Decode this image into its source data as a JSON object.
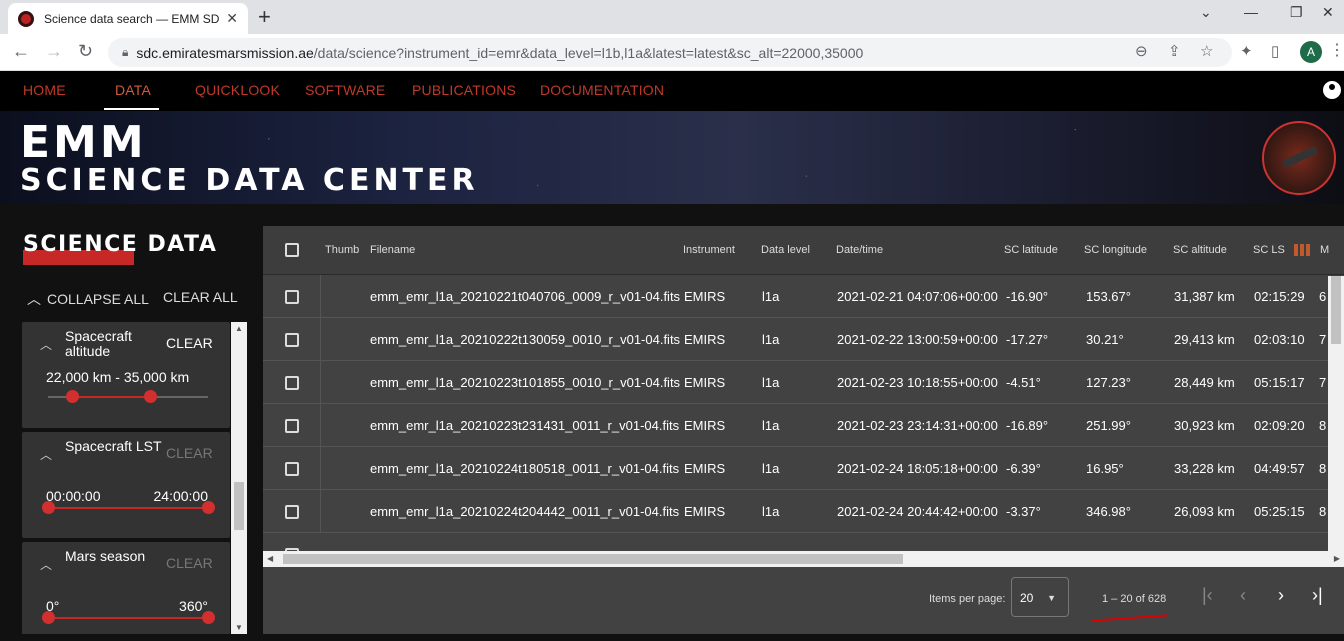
{
  "browser": {
    "tab_title": "Science data search — EMM SDC",
    "tab_close": "✕",
    "new_tab": "+",
    "url_host": "sdc.emiratesmarsmission.ae",
    "url_path": "/data/science?instrument_id=emr&data_level=l1b,l1a&latest=latest&sc_alt=22000,35000",
    "profile_initial": "A"
  },
  "nav": {
    "items": [
      "HOME",
      "DATA",
      "QUICKLOOK",
      "SOFTWARE",
      "PUBLICATIONS",
      "DOCUMENTATION"
    ],
    "active": "DATA"
  },
  "banner": {
    "line1": "EMM",
    "line2": "SCIENCE DATA CENTER"
  },
  "sidebar": {
    "title": "SCIENCE DATA",
    "collapse_all": "COLLAPSE ALL",
    "clear_all": "CLEAR ALL",
    "filters": [
      {
        "name": "Spacecraft altitude",
        "clear": "CLEAR",
        "active": true,
        "range_text": "22,000 km - 35,000 km",
        "min_label": "",
        "max_label": "",
        "low": 0.15,
        "high": 0.64
      },
      {
        "name": "Spacecraft LST",
        "clear": "CLEAR",
        "active": false,
        "range_text": "",
        "min_label": "00:00:00",
        "max_label": "24:00:00",
        "low": 0.0,
        "high": 1.0
      },
      {
        "name": "Mars season",
        "clear": "CLEAR",
        "active": false,
        "range_text": "",
        "min_label": "0°",
        "max_label": "360°",
        "low": 0.0,
        "high": 1.0
      }
    ]
  },
  "table": {
    "headers": {
      "thumb": "Thumb",
      "filename": "Filename",
      "instrument": "Instrument",
      "data_level": "Data level",
      "datetime": "Date/time",
      "sc_latitude": "SC latitude",
      "sc_longitude": "SC longitude",
      "sc_altitude": "SC altitude",
      "sc_lst": "SC LS",
      "extra": "M"
    },
    "rows": [
      {
        "filename": "emm_emr_l1a_20210221t040706_0009_r_v01-04.fits",
        "instrument": "EMIRS",
        "level": "l1a",
        "datetime": "2021-02-21 04:07:06+00:00",
        "lat": "-16.90°",
        "lon": "153.67°",
        "alt": "31,387 km",
        "lst": "02:15:29",
        "extra": "6"
      },
      {
        "filename": "emm_emr_l1a_20210222t130059_0010_r_v01-04.fits",
        "instrument": "EMIRS",
        "level": "l1a",
        "datetime": "2021-02-22 13:00:59+00:00",
        "lat": "-17.27°",
        "lon": "30.21°",
        "alt": "29,413 km",
        "lst": "02:03:10",
        "extra": "7"
      },
      {
        "filename": "emm_emr_l1a_20210223t101855_0010_r_v01-04.fits",
        "instrument": "EMIRS",
        "level": "l1a",
        "datetime": "2021-02-23 10:18:55+00:00",
        "lat": "-4.51°",
        "lon": "127.23°",
        "alt": "28,449 km",
        "lst": "05:15:17",
        "extra": "7"
      },
      {
        "filename": "emm_emr_l1a_20210223t231431_0011_r_v01-04.fits",
        "instrument": "EMIRS",
        "level": "l1a",
        "datetime": "2021-02-23 23:14:31+00:00",
        "lat": "-16.89°",
        "lon": "251.99°",
        "alt": "30,923 km",
        "lst": "02:09:20",
        "extra": "8"
      },
      {
        "filename": "emm_emr_l1a_20210224t180518_0011_r_v01-04.fits",
        "instrument": "EMIRS",
        "level": "l1a",
        "datetime": "2021-02-24 18:05:18+00:00",
        "lat": "-6.39°",
        "lon": "16.95°",
        "alt": "33,228 km",
        "lst": "04:49:57",
        "extra": "8"
      },
      {
        "filename": "emm_emr_l1a_20210224t204442_0011_r_v01-04.fits",
        "instrument": "EMIRS",
        "level": "l1a",
        "datetime": "2021-02-24 20:44:42+00:00",
        "lat": "-3.37°",
        "lon": "346.98°",
        "alt": "26,093 km",
        "lst": "05:25:15",
        "extra": "8"
      }
    ]
  },
  "paginator": {
    "items_per_page_label": "Items per page:",
    "items_per_page": "20",
    "range_label": "1 – 20 of 628"
  },
  "colors": {
    "accent_red": "#c62828",
    "nav_text": "#c0392b"
  }
}
